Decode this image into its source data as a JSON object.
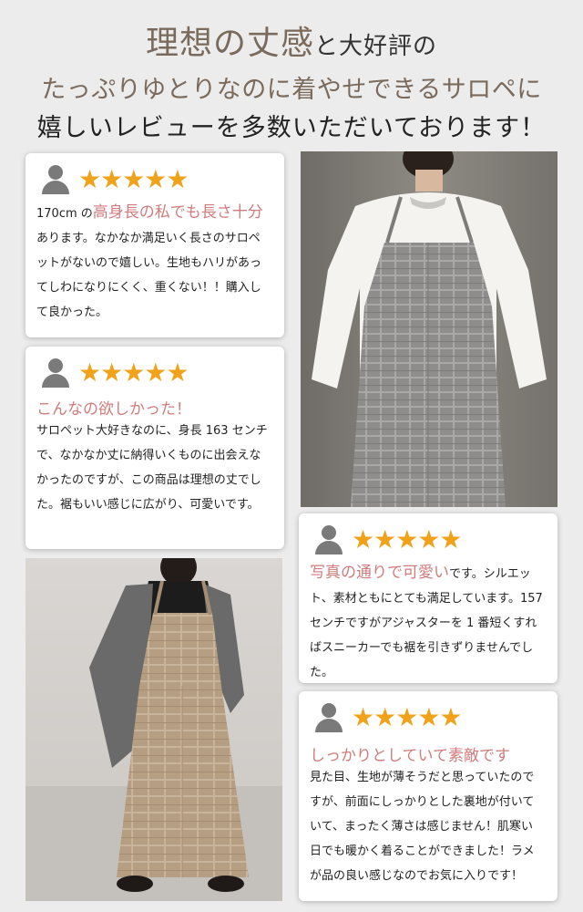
{
  "header": {
    "line1_big": "理想の丈感",
    "line1_small": "と大好評の",
    "line2": "たっぷりゆとりなのに着やせできるサロペに",
    "line3": "嬉しいレビューを多数いただいております！"
  },
  "reviews": [
    {
      "stars": "★★★★★",
      "prefix": "170cm の",
      "highlight": "高身長の私でも長さ十分",
      "text": "あります。なかなか満足いく長さのサロペットがないので嬉しい。生地もハリがあってしわになりにくく、重くない！！購入して良かった。"
    },
    {
      "stars": "★★★★★",
      "highlight": "こんなの欲しかった！",
      "text": "サロペット大好きなのに、身長 163 センチで、なかなか丈に納得いくものに出会えなかったのですが、この商品は理想の丈でした。裾もいい感じに広がり、可愛いです。"
    },
    {
      "stars": "★★★★★",
      "highlight": "写真の通りで可愛い",
      "text": "です。シルエット、素材ともにとても満足しています。157 センチですがアジャスターを 1 番短くすればスニーカーでも裾を引きずりませんでした。"
    },
    {
      "stars": "★★★★★",
      "highlight": "しっかりとしていて素敵です",
      "text": "見た目、生地が薄そうだと思っていたのですが、前面にしっかりとした裏地が付いていて、まったく薄さは感じません！肌寒い日でも暖かく着ることができました！ラメが品の良い感じなのでお気に入りです！"
    }
  ],
  "colors": {
    "accent_pink": "#d07c7c",
    "star_orange": "#f0a21b",
    "title_brown": "#7a6a5c"
  },
  "photos": [
    {
      "name": "gray-plaid-overalls-photo"
    },
    {
      "name": "beige-plaid-overalls-photo"
    }
  ]
}
